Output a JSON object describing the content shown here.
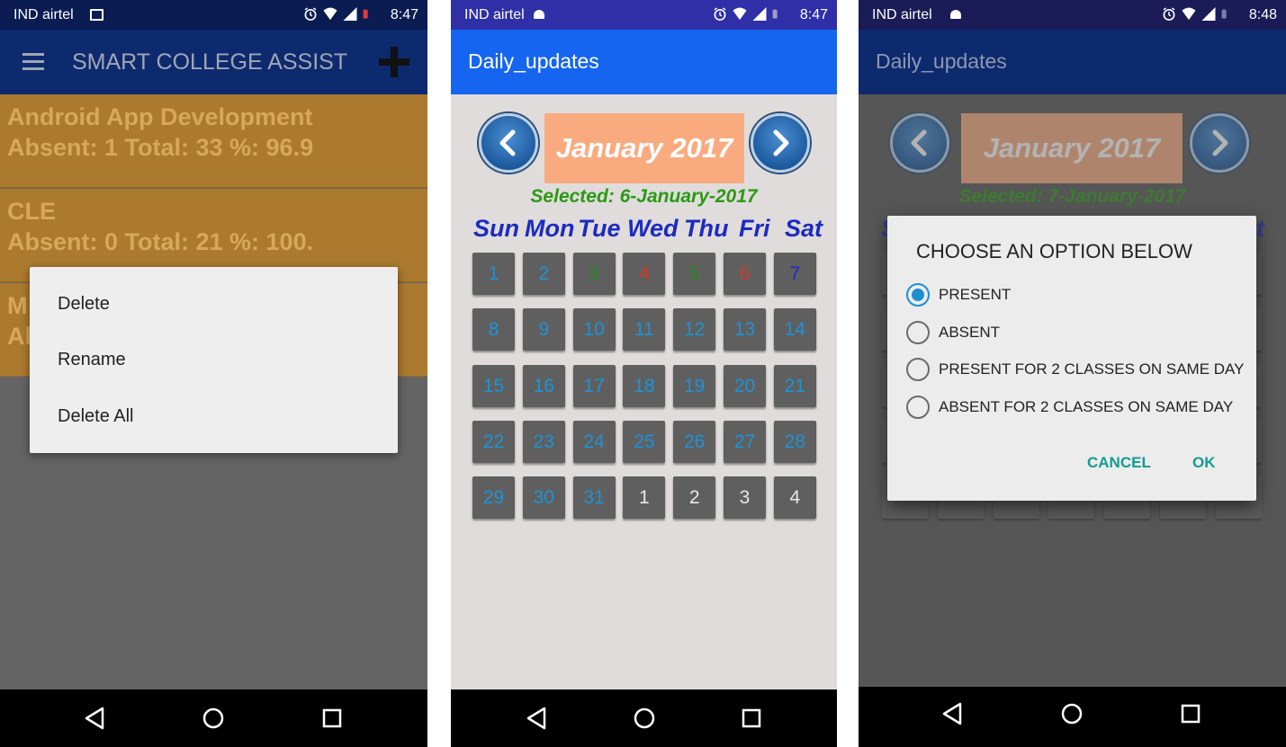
{
  "screen1": {
    "status": {
      "carrier": "IND airtel",
      "time": "8:47"
    },
    "app_title": "SMART COLLEGE ASSIST",
    "courses": [
      {
        "name": "Android App Development",
        "stats": "Absent: 1 Total: 33 %: 96.9"
      },
      {
        "name": "CLE",
        "stats": "Absent: 0 Total: 21 %: 100."
      },
      {
        "name": "M",
        "stats": "Al"
      }
    ],
    "context_menu": [
      "Delete",
      "Rename",
      "Delete All"
    ]
  },
  "screen2": {
    "status": {
      "carrier": "IND airtel",
      "time": "8:47"
    },
    "app_title": "Daily_updates",
    "month": "January 2017",
    "selected": "Selected: 6-January-2017",
    "weekdays": [
      "Sun",
      "Mon",
      "Tue",
      "Wed",
      "Thu",
      "Fri",
      "Sat"
    ],
    "days": [
      {
        "label": "1",
        "color": "#1d93d6"
      },
      {
        "label": "2",
        "color": "#1d93d6"
      },
      {
        "label": "3",
        "color": "#1f8a1a"
      },
      {
        "label": "4",
        "color": "#d23a2a"
      },
      {
        "label": "5",
        "color": "#1f8a1a"
      },
      {
        "label": "6",
        "color": "#d23a2a"
      },
      {
        "label": "7",
        "color": "#2228c8"
      },
      {
        "label": "8",
        "color": "#1d93d6"
      },
      {
        "label": "9",
        "color": "#1d93d6"
      },
      {
        "label": "10",
        "color": "#1d93d6"
      },
      {
        "label": "11",
        "color": "#1d93d6"
      },
      {
        "label": "12",
        "color": "#1d93d6"
      },
      {
        "label": "13",
        "color": "#1d93d6"
      },
      {
        "label": "14",
        "color": "#1d93d6"
      },
      {
        "label": "15",
        "color": "#1d93d6"
      },
      {
        "label": "16",
        "color": "#1d93d6"
      },
      {
        "label": "17",
        "color": "#1d93d6"
      },
      {
        "label": "18",
        "color": "#1d93d6"
      },
      {
        "label": "19",
        "color": "#1d93d6"
      },
      {
        "label": "20",
        "color": "#1d93d6"
      },
      {
        "label": "21",
        "color": "#1d93d6"
      },
      {
        "label": "22",
        "color": "#1d93d6"
      },
      {
        "label": "23",
        "color": "#1d93d6"
      },
      {
        "label": "24",
        "color": "#1d93d6"
      },
      {
        "label": "25",
        "color": "#1d93d6"
      },
      {
        "label": "26",
        "color": "#1d93d6"
      },
      {
        "label": "27",
        "color": "#1d93d6"
      },
      {
        "label": "28",
        "color": "#1d93d6"
      },
      {
        "label": "29",
        "color": "#1d93d6"
      },
      {
        "label": "30",
        "color": "#1d93d6"
      },
      {
        "label": "31",
        "color": "#1d93d6"
      },
      {
        "label": "1",
        "color": "#e8e8e8"
      },
      {
        "label": "2",
        "color": "#e8e8e8"
      },
      {
        "label": "3",
        "color": "#e8e8e8"
      },
      {
        "label": "4",
        "color": "#e8e8e8"
      }
    ]
  },
  "screen3": {
    "status": {
      "carrier": "IND airtel",
      "time": "8:48"
    },
    "app_title": "Daily_updates",
    "month": "January 2017",
    "selected": "Selected: 7-January-2017",
    "weekday_partial_sun": "S",
    "weekday_partial_sat": "t",
    "dialog": {
      "title": "CHOOSE AN OPTION BELOW",
      "options": [
        {
          "label": "PRESENT",
          "checked": true
        },
        {
          "label": "ABSENT",
          "checked": false
        },
        {
          "label": "PRESENT FOR 2 CLASSES ON SAME DAY",
          "checked": false
        },
        {
          "label": "ABSENT FOR 2 CLASSES ON SAME DAY",
          "checked": false
        }
      ],
      "cancel": "CANCEL",
      "ok": "OK"
    }
  },
  "icons": {
    "status": [
      "alarm-icon",
      "wifi-icon",
      "signal-icon",
      "battery-icon"
    ],
    "nav": [
      "back-icon",
      "home-icon",
      "recents-icon"
    ]
  }
}
